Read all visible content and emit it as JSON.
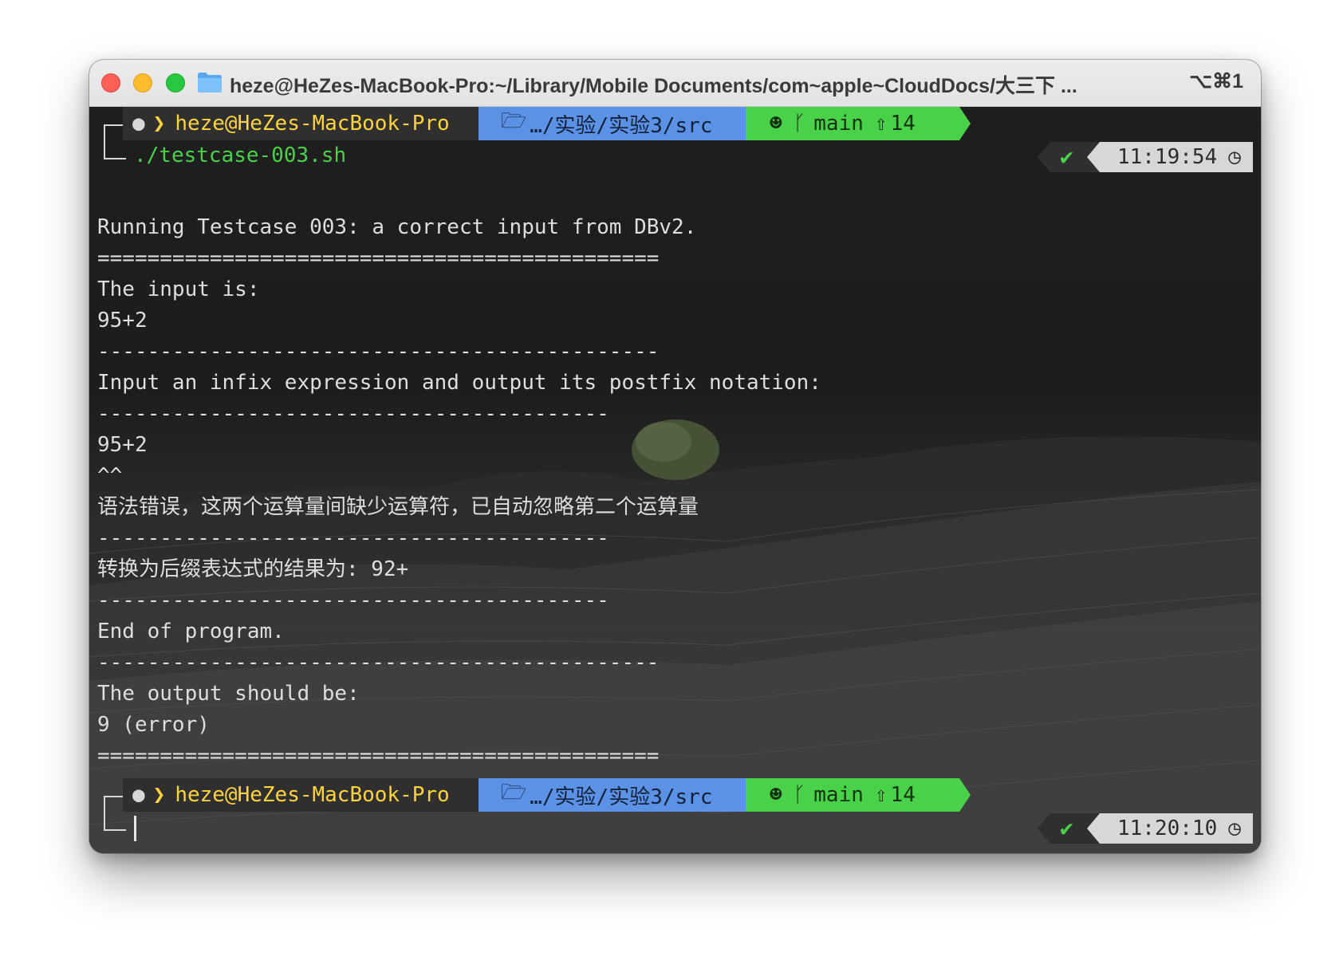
{
  "window": {
    "title": "heze@HeZes-MacBook-Pro:~/Library/Mobile Documents/com~apple~CloudDocs/大三下 ...",
    "shortcut": "⌥⌘1"
  },
  "prompt1": {
    "user": "heze@HeZes-MacBook-Pro",
    "path": "…/实验/实验3/src",
    "branch": "main",
    "ahead": "14",
    "command": "./testcase-003.sh",
    "time": "11:19:54"
  },
  "output": [
    "Running Testcase 003: a correct input from DBv2.",
    "=============================================",
    "The input is:",
    "95+2",
    "---------------------------------------------",
    "Input an infix expression and output its postfix notation:",
    "-----------------------------------------",
    "95+2",
    "^^",
    "语法错误，这两个运算量间缺少运算符，已自动忽略第二个运算量",
    "-----------------------------------------",
    "转换为后缀表达式的结果为: 92+",
    "-----------------------------------------",
    "End of program.",
    "---------------------------------------------",
    "The output should be:",
    "9 (error)",
    "============================================="
  ],
  "prompt2": {
    "user": "heze@HeZes-MacBook-Pro",
    "path": "…/实验/实验3/src",
    "branch": "main",
    "ahead": "14",
    "time": "11:20:10"
  },
  "colors": {
    "user_segment": "#2f2f2f",
    "user_text": "#ffd33d",
    "path_segment": "#5b92e5",
    "git_segment": "#4ad14a",
    "command_text": "#4ad14a",
    "time_segment": "#d7d7d7"
  }
}
